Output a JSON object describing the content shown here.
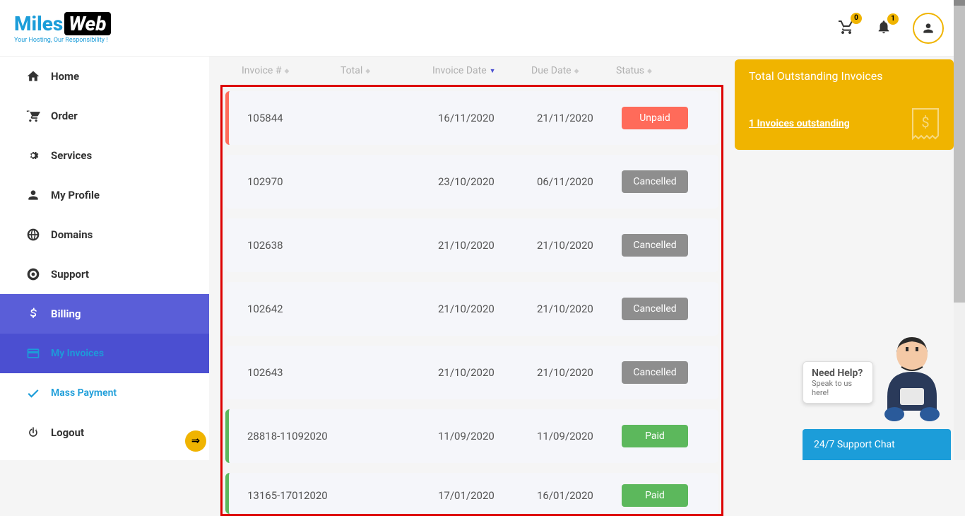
{
  "logo": {
    "part1": "Miles",
    "part2": "Web",
    "tagline": "Your Hosting, Our Responsibility !"
  },
  "header": {
    "cart_badge": "0",
    "notif_badge": "1"
  },
  "nav": {
    "home": "Home",
    "order": "Order",
    "services": "Services",
    "profile": "My Profile",
    "domains": "Domains",
    "support": "Support",
    "billing": "Billing",
    "invoices": "My Invoices",
    "mass": "Mass Payment",
    "logout": "Logout"
  },
  "table": {
    "headers": {
      "invoice": "Invoice #",
      "total": "Total",
      "idate": "Invoice Date",
      "ddate": "Due Date",
      "status": "Status"
    },
    "rows": [
      {
        "invoice": "105844",
        "idate": "16/11/2020",
        "ddate": "21/11/2020",
        "status": "Unpaid",
        "class": "unpaid"
      },
      {
        "invoice": "102970",
        "idate": "23/10/2020",
        "ddate": "06/11/2020",
        "status": "Cancelled",
        "class": "cancelled"
      },
      {
        "invoice": "102638",
        "idate": "21/10/2020",
        "ddate": "21/10/2020",
        "status": "Cancelled",
        "class": "cancelled"
      },
      {
        "invoice": "102642",
        "idate": "21/10/2020",
        "ddate": "21/10/2020",
        "status": "Cancelled",
        "class": "cancelled"
      },
      {
        "invoice": "102643",
        "idate": "21/10/2020",
        "ddate": "21/10/2020",
        "status": "Cancelled",
        "class": "cancelled"
      },
      {
        "invoice": "28818-11092020",
        "idate": "11/09/2020",
        "ddate": "11/09/2020",
        "status": "Paid",
        "class": "paid"
      },
      {
        "invoice": "13165-17012020",
        "idate": "17/01/2020",
        "ddate": "16/01/2020",
        "status": "Paid",
        "class": "paid"
      }
    ]
  },
  "outstanding": {
    "title": "Total Outstanding Invoices",
    "link": "1 Invoices outstanding"
  },
  "chat": {
    "help1": "Need Help?",
    "help2": "Speak to us here!",
    "bar": "24/7 Support Chat"
  }
}
